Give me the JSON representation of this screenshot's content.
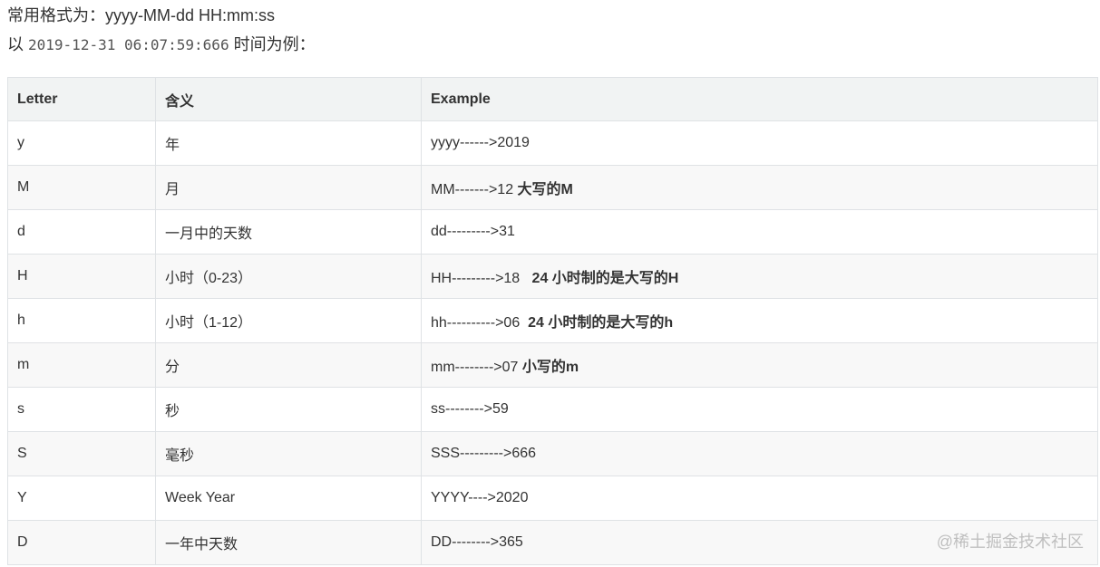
{
  "intro": {
    "line1": "常用格式为：yyyy-MM-dd HH:mm:ss",
    "line2_prefix": "以 ",
    "line2_code": "2019-12-31 06:07:59:666",
    "line2_suffix": " 时间为例："
  },
  "table": {
    "headers": [
      "Letter",
      "含义",
      "Example"
    ],
    "rows": [
      {
        "letter": "y",
        "meaning": "年",
        "example": "yyyy------>2019",
        "note": ""
      },
      {
        "letter": "M",
        "meaning": "月",
        "example": "MM------->12 ",
        "note": "大写的M"
      },
      {
        "letter": "d",
        "meaning": "一月中的天数",
        "example": "dd--------->31",
        "note": ""
      },
      {
        "letter": "H",
        "meaning": "小时（0-23）",
        "example": "HH--------->18   ",
        "note": "24 小时制的是大写的H"
      },
      {
        "letter": "h",
        "meaning": "小时（1-12）",
        "example": "hh---------->06  ",
        "note": "24 小时制的是大写的h"
      },
      {
        "letter": "m",
        "meaning": "分",
        "example": "mm-------->07 ",
        "note": "小写的m"
      },
      {
        "letter": "s",
        "meaning": "秒",
        "example": "ss-------->59",
        "note": ""
      },
      {
        "letter": "S",
        "meaning": "毫秒",
        "example": "SSS--------->666",
        "note": ""
      },
      {
        "letter": "Y",
        "meaning": "Week Year",
        "example": "YYYY---->2020",
        "note": ""
      },
      {
        "letter": "D",
        "meaning": "一年中天数",
        "example": "DD-------->365",
        "note": ""
      }
    ]
  },
  "watermark": "@稀土掘金技术社区"
}
